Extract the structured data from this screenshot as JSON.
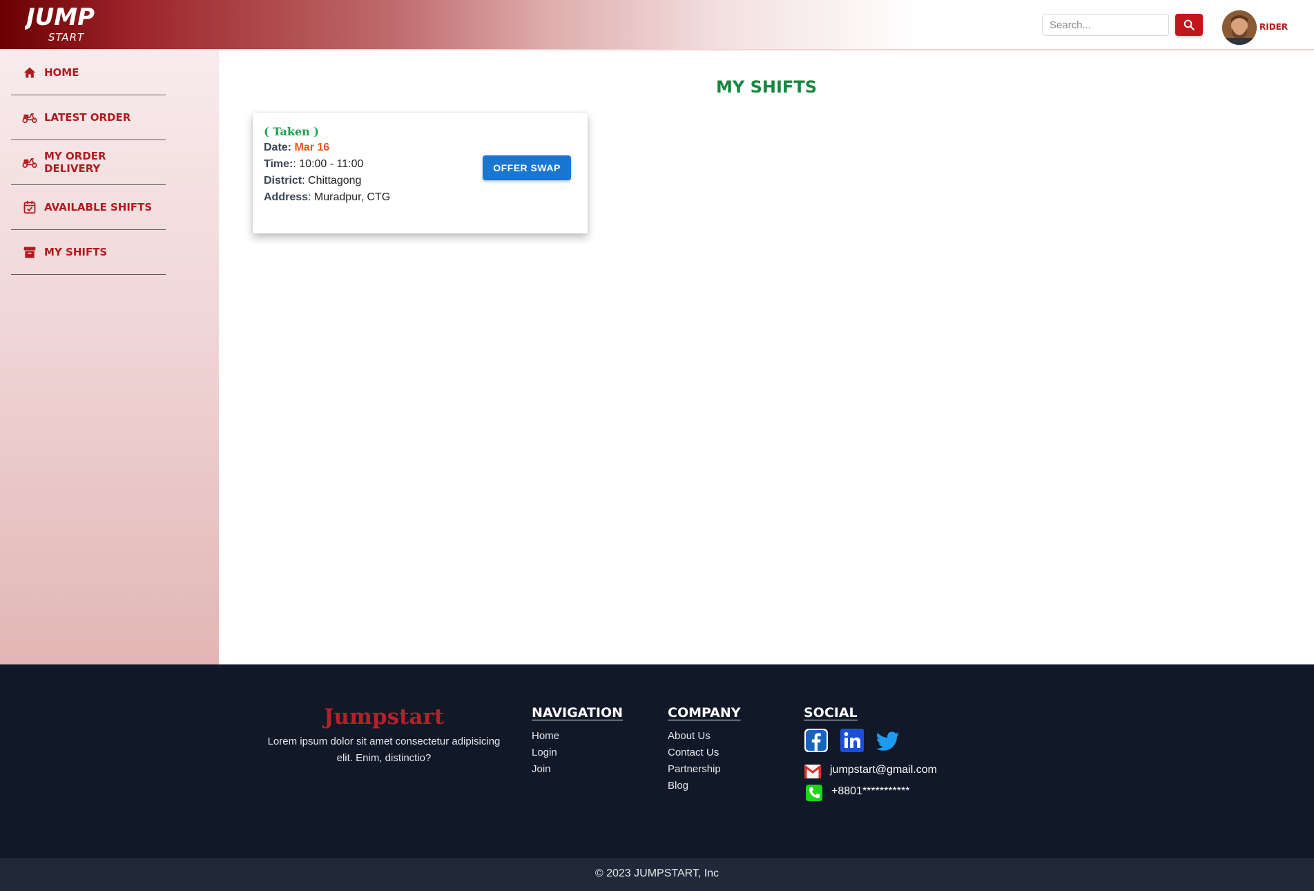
{
  "header": {
    "logo_text_top": "JUMP",
    "logo_text_bottom": "START",
    "search_placeholder": "Search...",
    "user_role": "RIDER"
  },
  "sidebar": {
    "items": [
      {
        "label": "HOME",
        "icon": "home-icon"
      },
      {
        "label": "LATEST ORDER",
        "icon": "scooter-icon"
      },
      {
        "label": "MY ORDER DELIVERY",
        "icon": "scooter-icon"
      },
      {
        "label": "AVAILABLE SHIFTS",
        "icon": "calendar-check-icon"
      },
      {
        "label": "MY SHIFTS",
        "icon": "archive-icon"
      }
    ]
  },
  "main": {
    "title": "MY SHIFTS",
    "shift_card": {
      "status": "( Taken )",
      "date_label": "Date:",
      "date_value": "Mar 16",
      "time_label": "Time:",
      "time_value": ": 10:00 - 11:00",
      "district_label": "District",
      "district_value": ": Chittagong",
      "address_label": "Address",
      "address_value": ": Muradpur, CTG",
      "action_label": "OFFER SWAP"
    }
  },
  "footer": {
    "brand": "Jumpstart",
    "description": "Lorem ipsum dolor sit amet consectetur adipisicing elit. Enim, distinctio?",
    "navigation": {
      "title": "NAVIGATION",
      "links": [
        "Home",
        "Login",
        "Join"
      ]
    },
    "company": {
      "title": "COMPANY",
      "links": [
        "About Us",
        "Contact Us",
        "Partnership",
        "Blog"
      ]
    },
    "social": {
      "title": "SOCIAL",
      "icons": [
        "facebook-icon",
        "linkedin-icon",
        "twitter-icon"
      ],
      "email": "jumpstart@gmail.com",
      "phone": "+8801***********"
    },
    "copyright": "© 2023 JUMPSTART, Inc"
  },
  "colors": {
    "brand_red": "#b01a1f",
    "title_green": "#14883e",
    "date_orange": "#e2571e",
    "button_blue": "#1976d2",
    "footer_bg": "#111827"
  }
}
